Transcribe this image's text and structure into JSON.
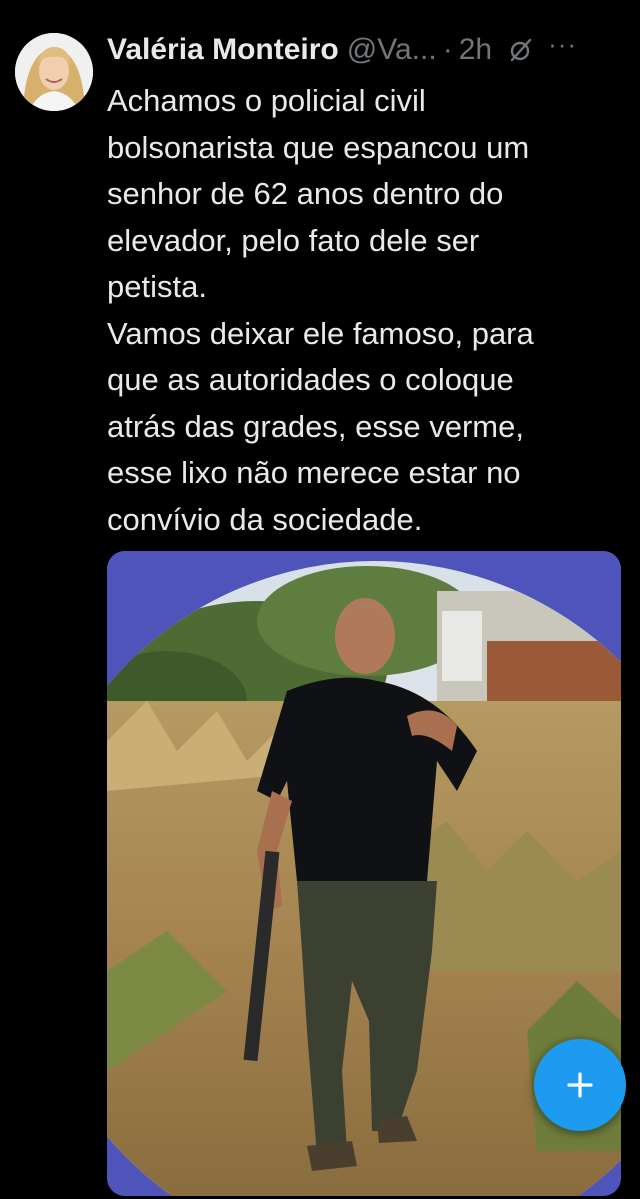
{
  "tweet": {
    "display_name": "Valéria Monteiro",
    "handle": "@Va...",
    "separator": "·",
    "time": "2h",
    "text": "Achamos o policial civil\nbolsonarista que espancou um\nsenhor de 62 anos dentro do\nelevador, pelo fato dele ser\npetista.\nVamos deixar ele famoso, para\nque as autoridades o coloque\natrás das grades, esse verme,\nesse lixo não merece estar no\nconvívio da sociedade."
  },
  "icons": {
    "grok": "grok-icon",
    "more": "more-icon",
    "compose": "plus-icon"
  },
  "colors": {
    "background": "#000000",
    "text": "#e7e9ea",
    "muted": "#71767b",
    "accent": "#1d9bf0",
    "media_frame": "#4f55b8"
  }
}
